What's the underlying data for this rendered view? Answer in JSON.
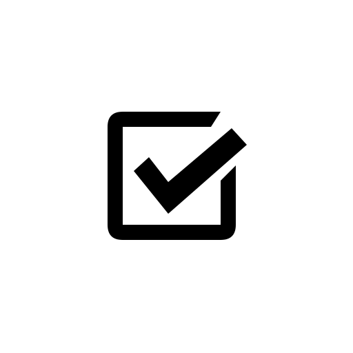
{
  "icon": {
    "name": "checkbox-checked-icon",
    "color": "#000000",
    "background": "#ffffff",
    "checked": true
  }
}
